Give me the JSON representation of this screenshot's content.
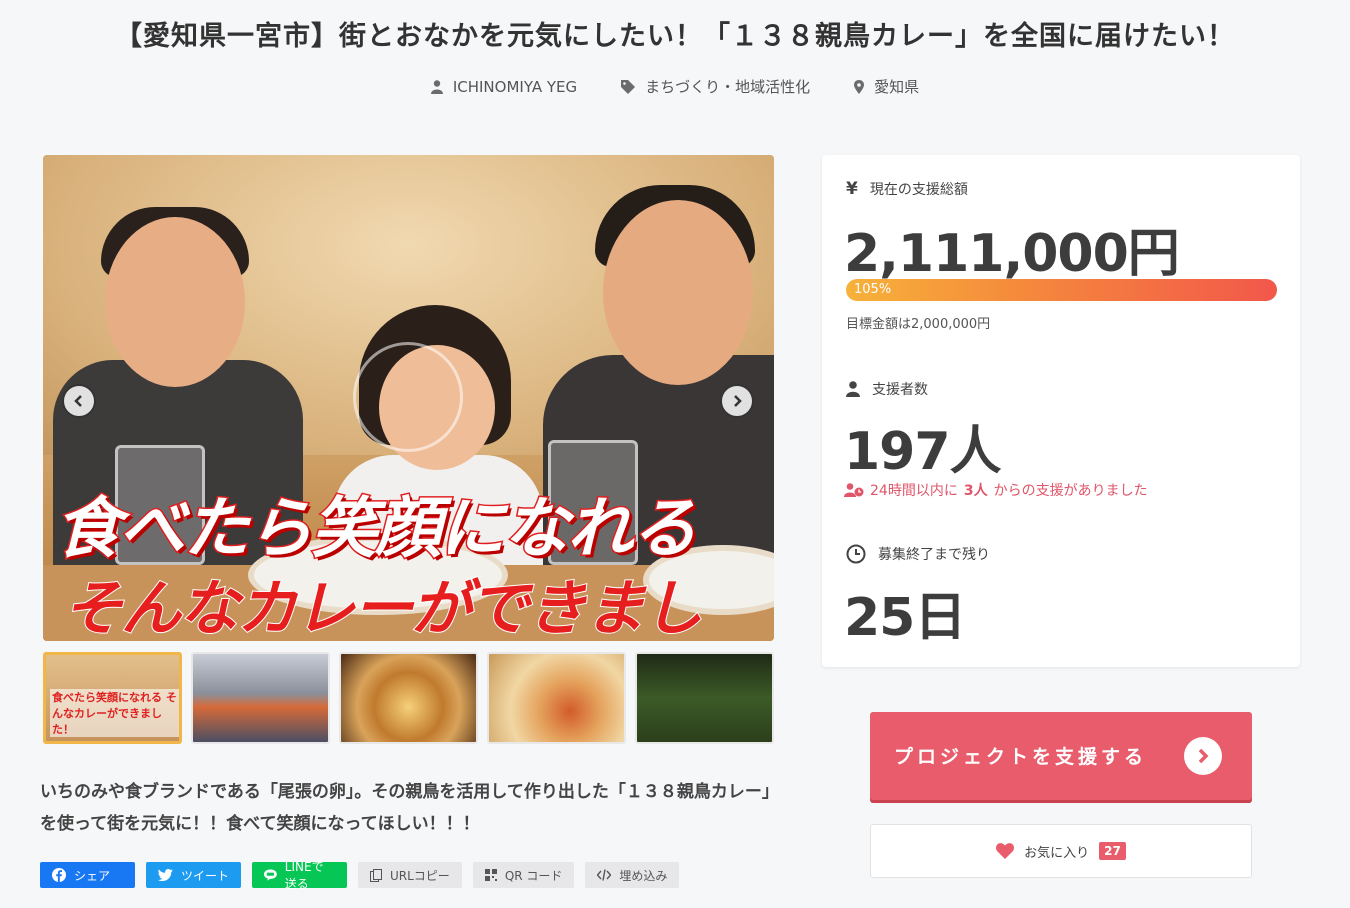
{
  "project": {
    "title": "【愛知県一宮市】街とおなかを元気にしたい！「１３８親鳥カレー」を全国に届けたい！",
    "owner": "ICHINOMIYA YEG",
    "category": "まちづくり・地域活性化",
    "location": "愛知県"
  },
  "hero": {
    "overlay_line1": "食べたら笑顔になれる",
    "overlay_line2": "そんなカレーができました！"
  },
  "thumbnails": [
    {
      "caption": "食べたら笑顔になれる そんなカレーができました！",
      "active": true
    },
    {
      "caption": "",
      "active": false
    },
    {
      "caption": "",
      "active": false
    },
    {
      "caption": "",
      "active": false
    },
    {
      "caption": "",
      "active": false
    }
  ],
  "description": "いちのみや食ブランドである「尾張の卵」。その親鳥を活用して作り出した「１３８親鳥カレー」を使って街を元気に！！食べて笑顔になってほしい！！！",
  "share": {
    "facebook": "シェア",
    "twitter": "ツイート",
    "line": "LINEで送る",
    "url_copy": "URLコピー",
    "qr": "QR コード",
    "embed": "埋め込み"
  },
  "stats": {
    "amount_label": "現在の支援総額",
    "amount": "2,111,000円",
    "progress_percent": 105,
    "progress_label": "105%",
    "goal": "目標金額は2,000,000円",
    "supporters_label": "支援者数",
    "supporters": "197人",
    "recent_prefix": "24時間以内に",
    "recent_count": "3人",
    "recent_suffix": "からの支援がありました",
    "remaining_label": "募集終了まで残り",
    "remaining": "25日"
  },
  "actions": {
    "support_label": "プロジェクトを支援する",
    "favorite_label": "お気に入り",
    "favorite_count": "27"
  },
  "colors": {
    "accent": "#e85c6b",
    "progress_start": "#f6b23a",
    "progress_end": "#f2574a",
    "facebook": "#1877f2",
    "twitter": "#1d9bf0",
    "line": "#06c755"
  }
}
